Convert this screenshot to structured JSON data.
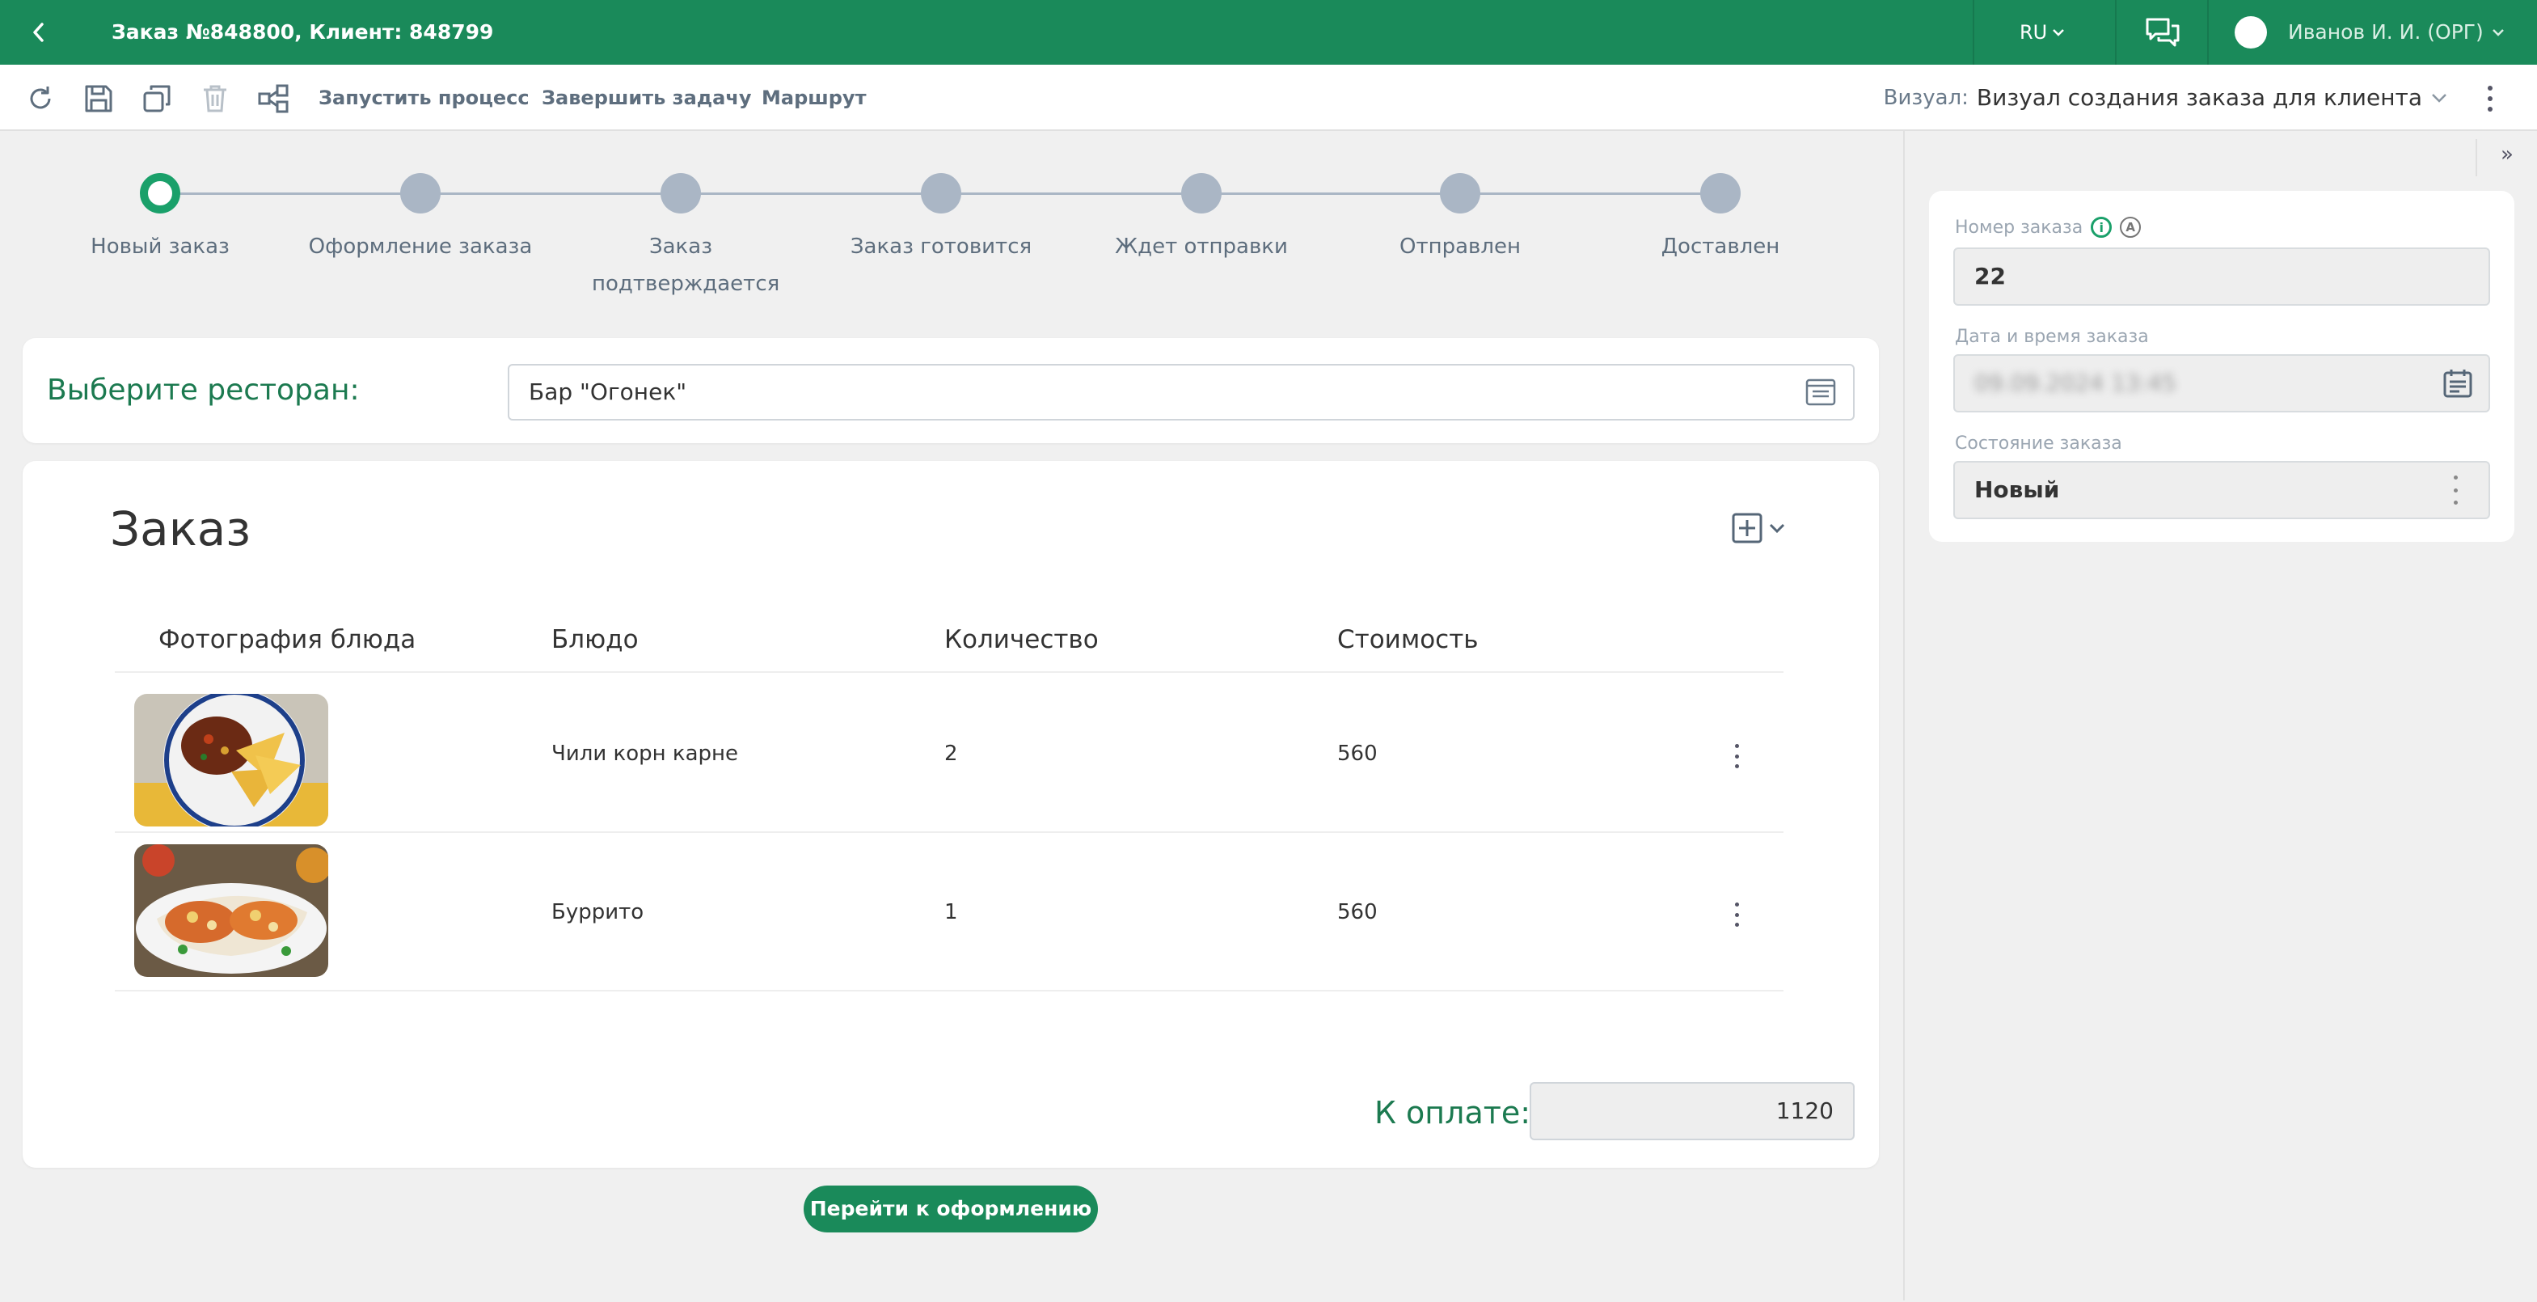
{
  "topbar": {
    "title": "Заказ №848800, Клиент: 848799",
    "language": "RU",
    "user_name": "Иванов И. И. (ОРГ)"
  },
  "toolbar": {
    "start_process": "Запустить процесс",
    "finish_task": "Завершить задачу",
    "route": "Маршрут",
    "visual_label": "Визуал:",
    "visual_value": "Визуал создания заказа для клиента"
  },
  "stepper": {
    "steps": [
      {
        "label": "Новый заказ",
        "active": true
      },
      {
        "label": "Оформление заказа",
        "active": false
      },
      {
        "label": "Заказ подтверждается",
        "active": false
      },
      {
        "label": "Заказ готовится",
        "active": false
      },
      {
        "label": "Ждет отправки",
        "active": false
      },
      {
        "label": "Отправлен",
        "active": false
      },
      {
        "label": "Доставлен",
        "active": false
      }
    ]
  },
  "restaurant": {
    "label": "Выберите ресторан:",
    "value": "Бар \"Огонек\""
  },
  "order": {
    "title": "Заказ",
    "columns": [
      "Фотография блюда",
      "Блюдо",
      "Количество",
      "Стоимость"
    ],
    "rows": [
      {
        "dish": "Чили корн карне",
        "quantity": "2",
        "cost": "560"
      },
      {
        "dish": "Буррито",
        "quantity": "1",
        "cost": "560"
      }
    ],
    "total_label": "К оплате:",
    "total_value": "1120"
  },
  "goto_button": "Перейти к оформлению",
  "side_panel": {
    "order_number_label": "Номер заказа",
    "order_number_value": "22",
    "datetime_label": "Дата и время заказа",
    "datetime_value": "09.09.2024 13:45",
    "status_label": "Состояние заказа",
    "status_value": "Новый"
  },
  "colors": {
    "brand_green": "#1a8a5a",
    "step_active": "#1aa06a",
    "step_inactive": "#aab6c5",
    "label_green": "#1c7a50"
  }
}
